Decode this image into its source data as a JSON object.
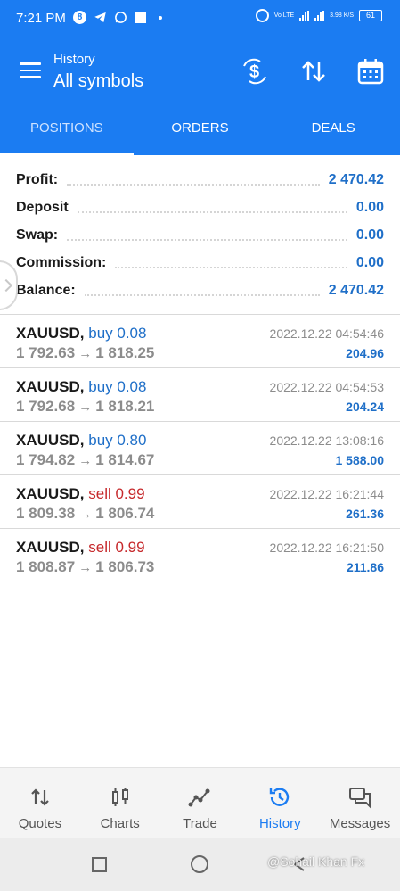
{
  "status_bar": {
    "time": "7:21 PM",
    "network_label": "Vo LTE",
    "speed": "3.98 K/S",
    "battery": "61",
    "icons": [
      "app-badge-icon",
      "telegram-icon",
      "whatsapp-icon",
      "square-icon",
      "alarm-icon",
      "signal-icon",
      "battery-icon"
    ]
  },
  "header": {
    "subtitle": "History",
    "title": "All symbols",
    "icons": [
      "menu-icon",
      "currency-exchange-icon",
      "sort-icon",
      "calendar-icon"
    ]
  },
  "tabs": [
    {
      "label": "POSITIONS",
      "active": true
    },
    {
      "label": "ORDERS",
      "active": false
    },
    {
      "label": "DEALS",
      "active": false
    }
  ],
  "summary": {
    "profit": {
      "label": "Profit:",
      "value": "2 470.42"
    },
    "deposit": {
      "label": "Deposit",
      "value": "0.00"
    },
    "swap": {
      "label": "Swap:",
      "value": "0.00"
    },
    "commission": {
      "label": "Commission:",
      "value": "0.00"
    },
    "balance": {
      "label": "Balance:",
      "value": "2 470.42"
    }
  },
  "deals": [
    {
      "symbol": "XAUUSD,",
      "side": "buy 0.08",
      "type": "buy",
      "open": "1 792.63",
      "arrow": "→",
      "close": "1 818.25",
      "time": "2022.12.22 04:54:46",
      "profit": "204.96"
    },
    {
      "symbol": "XAUUSD,",
      "side": "buy 0.08",
      "type": "buy",
      "open": "1 792.68",
      "arrow": "→",
      "close": "1 818.21",
      "time": "2022.12.22 04:54:53",
      "profit": "204.24"
    },
    {
      "symbol": "XAUUSD,",
      "side": "buy 0.80",
      "type": "buy",
      "open": "1 794.82",
      "arrow": "→",
      "close": "1 814.67",
      "time": "2022.12.22 13:08:16",
      "profit": "1 588.00"
    },
    {
      "symbol": "XAUUSD,",
      "side": "sell 0.99",
      "type": "sell",
      "open": "1 809.38",
      "arrow": "→",
      "close": "1 806.74",
      "time": "2022.12.22 16:21:44",
      "profit": "261.36"
    },
    {
      "symbol": "XAUUSD,",
      "side": "sell 0.99",
      "type": "sell",
      "open": "1 808.87",
      "arrow": "→",
      "close": "1 806.73",
      "time": "2022.12.22 16:21:50",
      "profit": "211.86"
    }
  ],
  "bottom_nav": [
    {
      "label": "Quotes",
      "icon": "quotes-icon",
      "active": false
    },
    {
      "label": "Charts",
      "icon": "charts-icon",
      "active": false
    },
    {
      "label": "Trade",
      "icon": "trade-icon",
      "active": false
    },
    {
      "label": "History",
      "icon": "history-icon",
      "active": true
    },
    {
      "label": "Messages",
      "icon": "messages-icon",
      "active": false
    }
  ],
  "watermark": "@Sohail Khan Fx",
  "colors": {
    "primary": "#1b7cf2",
    "buy": "#1f6fc8",
    "sell": "#c6282b",
    "muted": "#8c8c8c"
  }
}
